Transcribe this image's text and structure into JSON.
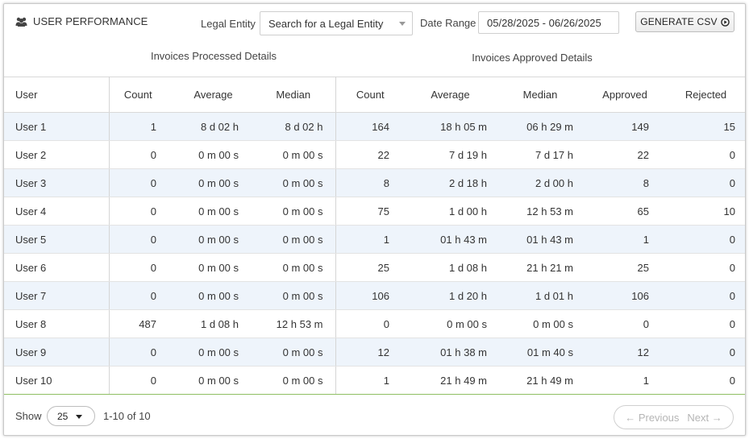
{
  "header": {
    "title": "USER PERFORMANCE",
    "legal_entity_label": "Legal Entity",
    "legal_entity_placeholder": "Search for a Legal Entity",
    "date_range_label": "Date Range",
    "date_range_value": "05/28/2025 - 06/26/2025",
    "csv_button_label": "GENERATE CSV"
  },
  "groups": {
    "processed": "Invoices Processed Details",
    "approved": "Invoices Approved Details"
  },
  "columns": [
    "User",
    "Count",
    "Average",
    "Median",
    "Count",
    "Average",
    "Median",
    "Approved",
    "Rejected"
  ],
  "rows": [
    [
      "User 1",
      "1",
      "8 d 02 h",
      "8 d 02 h",
      "164",
      "18 h 05 m",
      "06 h 29 m",
      "149",
      "15"
    ],
    [
      "User 2",
      "0",
      "0 m 00 s",
      "0 m 00 s",
      "22",
      "7 d 19 h",
      "7 d 17 h",
      "22",
      "0"
    ],
    [
      "User 3",
      "0",
      "0 m 00 s",
      "0 m 00 s",
      "8",
      "2 d 18 h",
      "2 d 00 h",
      "8",
      "0"
    ],
    [
      "User 4",
      "0",
      "0 m 00 s",
      "0 m 00 s",
      "75",
      "1 d 00 h",
      "12 h 53 m",
      "65",
      "10"
    ],
    [
      "User 5",
      "0",
      "0 m 00 s",
      "0 m 00 s",
      "1",
      "01 h 43 m",
      "01 h 43 m",
      "1",
      "0"
    ],
    [
      "User 6",
      "0",
      "0 m 00 s",
      "0 m 00 s",
      "25",
      "1 d 08 h",
      "21 h 21 m",
      "25",
      "0"
    ],
    [
      "User 7",
      "0",
      "0 m 00 s",
      "0 m 00 s",
      "106",
      "1 d 20 h",
      "1 d 01 h",
      "106",
      "0"
    ],
    [
      "User 8",
      "487",
      "1 d 08 h",
      "12 h 53 m",
      "0",
      "0 m 00 s",
      "0 m 00 s",
      "0",
      "0"
    ],
    [
      "User 9",
      "0",
      "0 m 00 s",
      "0 m 00 s",
      "12",
      "01 h 38 m",
      "01 m 40 s",
      "12",
      "0"
    ],
    [
      "User 10",
      "0",
      "0 m 00 s",
      "0 m 00 s",
      "1",
      "21 h 49 m",
      "21 h 49 m",
      "1",
      "0"
    ]
  ],
  "footer": {
    "show_label": "Show",
    "page_size": "25",
    "range_text": "1-10 of 10",
    "previous_label": "← Previous",
    "next_label": "Next →"
  },
  "icons": {
    "title_icon": "users-icon",
    "csv_icon": "play-circle-icon"
  },
  "colors": {
    "row_stripe": "#eef4fb",
    "last_row_border": "#8fbf63"
  }
}
